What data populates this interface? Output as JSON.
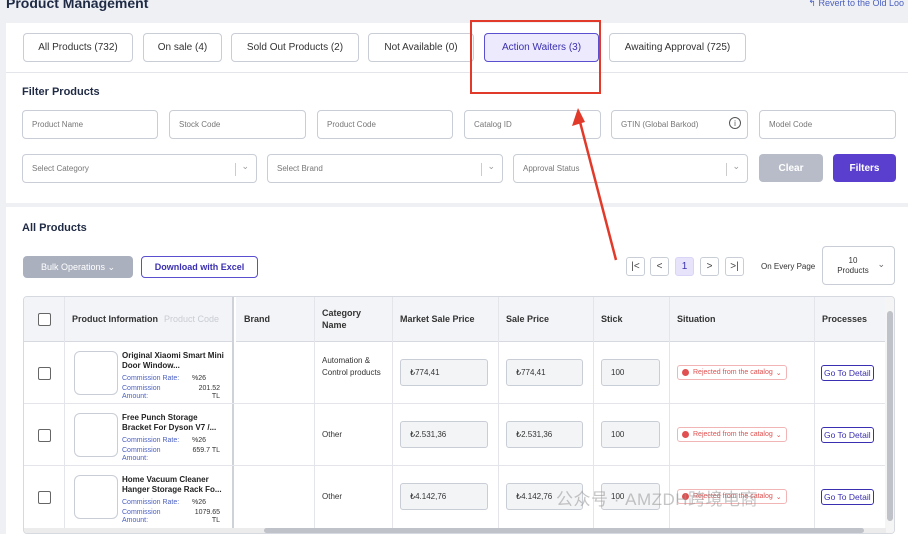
{
  "page": {
    "title": "Product Management",
    "revert_label": "↰ Revert to the Old Loo"
  },
  "tabs": [
    {
      "label": "All Products (732)"
    },
    {
      "label": "On sale (4)"
    },
    {
      "label": "Sold Out Products (2)"
    },
    {
      "label": "Not Available (0)"
    },
    {
      "label": "Action Waiters (3)",
      "active": true
    },
    {
      "label": "Awaiting Approval (725)"
    }
  ],
  "filter": {
    "heading": "Filter Products",
    "inputs": {
      "product_name": "Product Name",
      "stock_code": "Stock Code",
      "product_code": "Product Code",
      "catalog_id": "Catalog ID",
      "gtin": "GTIN (Global Barkod)",
      "model_code": "Model Code"
    },
    "selects": {
      "category": "Select Category",
      "brand": "Select Brand",
      "approval": "Approval Status"
    },
    "clear_label": "Clear",
    "filters_label": "Filters"
  },
  "products": {
    "heading": "All Products",
    "bulk_label": "Bulk Operations ⌄",
    "download_label": "Download with Excel",
    "pagination": {
      "first": "|<",
      "prev": "<",
      "current": "1",
      "next": ">",
      "last": ">|"
    },
    "per_page_label": "On Every Page",
    "per_page_value": "10",
    "per_page_unit": "Products"
  },
  "table": {
    "headers": {
      "product_info": "Product Information",
      "product_code_ghost": "Product Code",
      "brand": "Brand",
      "category": "Category Name",
      "market_price": "Market Sale Price",
      "sale_price": "Sale Price",
      "stock": "Stick",
      "situation": "Situation",
      "processes": "Processes"
    },
    "rows": [
      {
        "name": "Original Xiaomi Smart Mini Door Window...",
        "rate_label": "Commission Rate:",
        "rate": "%26",
        "amount_label": "Commission Amount:",
        "amount": "201.52 TL",
        "category": "Automation & Control products",
        "market_price": "₺774,41",
        "sale_price": "₺774,41",
        "stock": "100",
        "status": "Rejected from the catalog",
        "action": "Go To Detail"
      },
      {
        "name": "Free Punch Storage Bracket For Dyson V7 /...",
        "rate_label": "Commission Rate:",
        "rate": "%26",
        "amount_label": "Commission Amount:",
        "amount": "659.7 TL",
        "category": "Other",
        "market_price": "₺2.531,36",
        "sale_price": "₺2.531,36",
        "stock": "100",
        "status": "Rejected from the catalog",
        "action": "Go To Detail"
      },
      {
        "name": "Home Vacuum Cleaner Hanger Storage Rack Fo...",
        "rate_label": "Commission Rate:",
        "rate": "%26",
        "amount_label": "Commission Amount:",
        "amount": "1079.65 TL",
        "category": "Other",
        "market_price": "₺4.142,76",
        "sale_price": "₺4.142,76",
        "stock": "100",
        "status": "Rejected from the catalog",
        "action": "Go To Detail"
      }
    ]
  },
  "watermark": "公众号 · AMZDH跨境电商",
  "colors": {
    "accent": "#5a3fcf",
    "annotation": "#e23a2a",
    "reject": "#e05050"
  }
}
